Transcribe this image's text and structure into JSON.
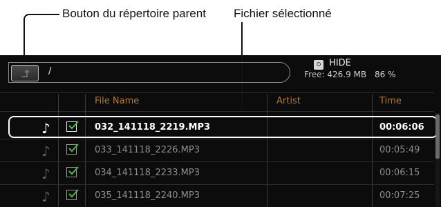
{
  "callouts": {
    "parent_button": "Bouton du répertoire parent",
    "selected_file": "Fichier sélectionné"
  },
  "toolbar": {
    "up_icon": "up-arrow-icon",
    "path": "/",
    "storage_icon": "usb-storage-icon",
    "hide_label": "HIDE",
    "free_label": "Free:",
    "free_size": "426.9 MB",
    "free_percent": "86 %"
  },
  "columns": {
    "file_name": "File Name",
    "artist": "Artist",
    "time": "Time"
  },
  "files": [
    {
      "name": "032_141118_2219.MP3",
      "artist": "",
      "time": "00:06:06",
      "checked": true,
      "selected": true
    },
    {
      "name": "033_141118_2226.MP3",
      "artist": "",
      "time": "00:05:49",
      "checked": true,
      "selected": false
    },
    {
      "name": "034_141118_2233.MP3",
      "artist": "",
      "time": "00:06:15",
      "checked": true,
      "selected": false
    },
    {
      "name": "035_141118_2240.MP3",
      "artist": "",
      "time": "00:07:25",
      "checked": true,
      "selected": false
    }
  ],
  "icons": {
    "note": "music-note-icon",
    "check": "checkbox-checked-icon"
  },
  "colors": {
    "header_text": "#b07a35",
    "background": "#0c0c0c",
    "selected_text": "#ffffff",
    "dim_text": "#8d8d8d"
  }
}
